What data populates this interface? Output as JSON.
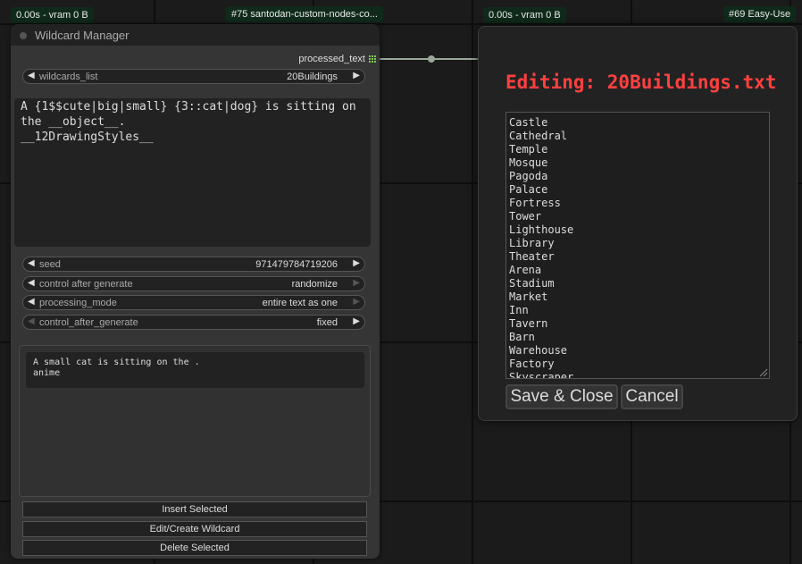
{
  "badges": {
    "left_timing": "0.00s - vram 0 B",
    "node75": "#75 santodan-custom-nodes-co...",
    "right_timing": "0.00s - vram 0 B",
    "node69": "#69 Easy-Use"
  },
  "node": {
    "title": "Wildcard Manager",
    "output_label": "processed_text",
    "wildcards_list": {
      "label": "wildcards_list",
      "value": "20Buildings"
    },
    "prompt_text": "A {1$$cute|big|small} {3::cat|dog} is sitting on\nthe __object__.\n__12DrawingStyles__",
    "widgets": [
      {
        "label": "seed",
        "value": "971479784719206"
      },
      {
        "label": "control after generate",
        "value": "randomize"
      },
      {
        "label": "processing_mode",
        "value": "entire text as one"
      },
      {
        "label": "control_after_generate",
        "value": "fixed"
      }
    ],
    "output_text": "A small cat is sitting on the .\nanime",
    "buttons": {
      "insert": "Insert Selected",
      "edit": "Edit/Create Wildcard",
      "delete": "Delete Selected"
    }
  },
  "dialog": {
    "title": "Editing: 20Buildings.txt",
    "lines": [
      "Castle",
      "Cathedral",
      "Temple",
      "Mosque",
      "Pagoda",
      "Palace",
      "Fortress",
      "Tower",
      "Lighthouse",
      "Library",
      "Theater",
      "Arena",
      "Stadium",
      "Market",
      "Inn",
      "Tavern",
      "Barn",
      "Warehouse",
      "Factory",
      "Skyscraper"
    ],
    "save_label": "Save & Close",
    "cancel_label": "Cancel"
  },
  "colors": {
    "title_red": "#ff4040",
    "badge_bg": "#0f2a1a",
    "output_dot": "#7ec850"
  },
  "icons": {
    "arrow_left": "◀",
    "arrow_right": "▶"
  }
}
